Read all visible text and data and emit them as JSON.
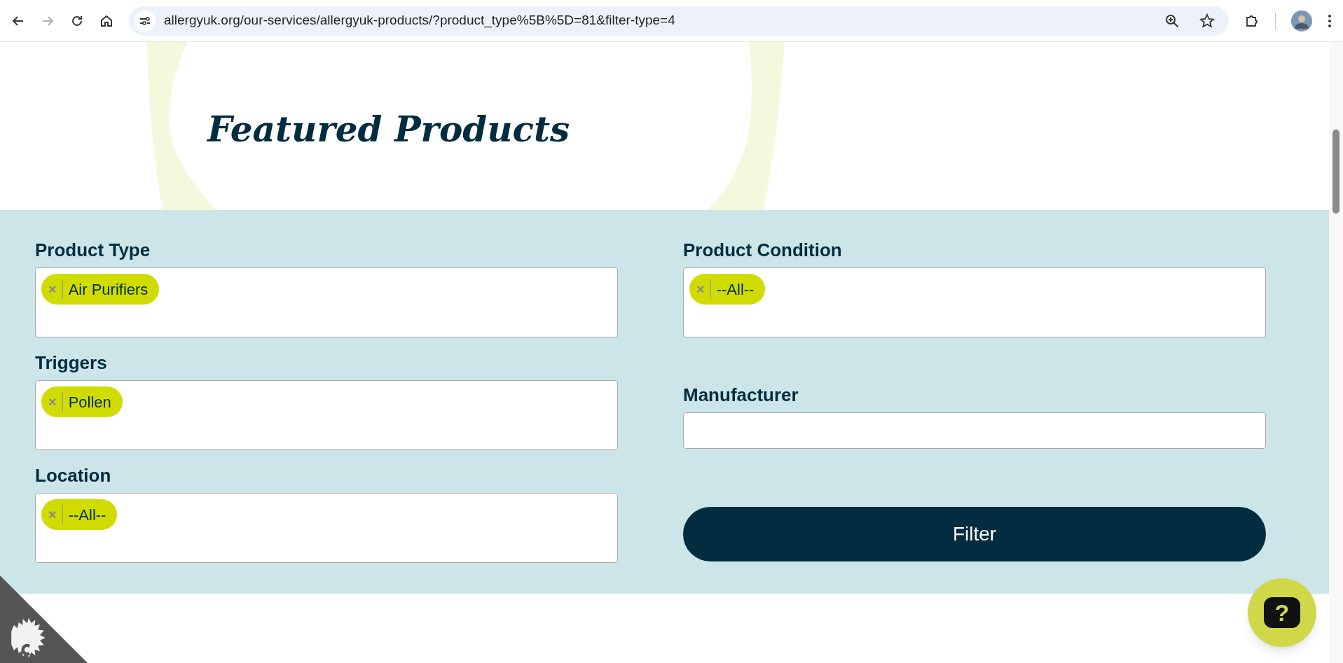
{
  "browser": {
    "url": "allergyuk.org/our-services/allergyuk-products/?product_type%5B%5D=81&filter-type=4",
    "forward_disabled": true
  },
  "heading": "Featured Products",
  "left_column": [
    {
      "label": "Product Type",
      "kind": "multi",
      "tags": [
        {
          "text": "Air Purifiers",
          "remove": "×"
        }
      ]
    },
    {
      "label": "Triggers",
      "kind": "multi",
      "tags": [
        {
          "text": "Pollen",
          "remove": "×"
        }
      ]
    },
    {
      "label": "Location",
      "kind": "multi",
      "tags": [
        {
          "text": "--All--",
          "remove": "×"
        }
      ]
    }
  ],
  "right_column": [
    {
      "label": "Product Condition",
      "kind": "multi",
      "tags": [
        {
          "text": "--All--",
          "remove": "×"
        }
      ]
    },
    {
      "label": "Manufacturer",
      "kind": "single"
    }
  ],
  "filter_button": "Filter",
  "help_button": "?"
}
